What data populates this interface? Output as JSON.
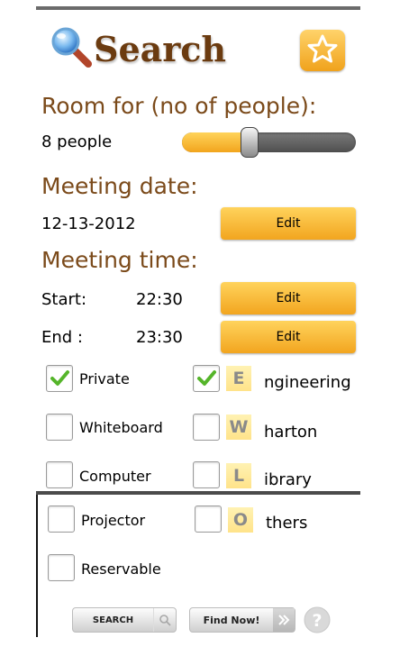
{
  "header": {
    "title": "Search"
  },
  "room": {
    "heading": "Room for (no of people):",
    "value_text": "8 people",
    "slider_level": 0.37
  },
  "date": {
    "heading": "Meeting date:",
    "value": "12-13-2012",
    "edit_label": "Edit"
  },
  "time": {
    "heading": "Meeting time:",
    "start_label": "Start:",
    "start_value": "22:30",
    "start_edit_label": "Edit",
    "end_label": "End :",
    "end_value": "23:30",
    "end_edit_label": "Edit"
  },
  "options": {
    "private": {
      "label": "Private",
      "checked": true
    },
    "whiteboard": {
      "label": "Whiteboard",
      "checked": false
    },
    "computer": {
      "label": "Computer",
      "checked": false
    },
    "projector": {
      "label": "Projector",
      "checked": false
    },
    "reservable": {
      "label": "Reservable",
      "checked": false
    }
  },
  "locations": {
    "engineering": {
      "letter": "E",
      "rest": "ngineering",
      "checked": true
    },
    "wharton": {
      "letter": "W",
      "rest": "harton",
      "checked": false
    },
    "library": {
      "letter": "L",
      "rest": "ibrary",
      "checked": false
    },
    "others": {
      "letter": "O",
      "rest": "thers",
      "checked": false
    }
  },
  "footer": {
    "search_label": "SEARCH",
    "find_label": "Find Now!"
  },
  "colors": {
    "accent": "#f2a51f",
    "heading": "#7b4a1a",
    "check": "#55b52a"
  }
}
